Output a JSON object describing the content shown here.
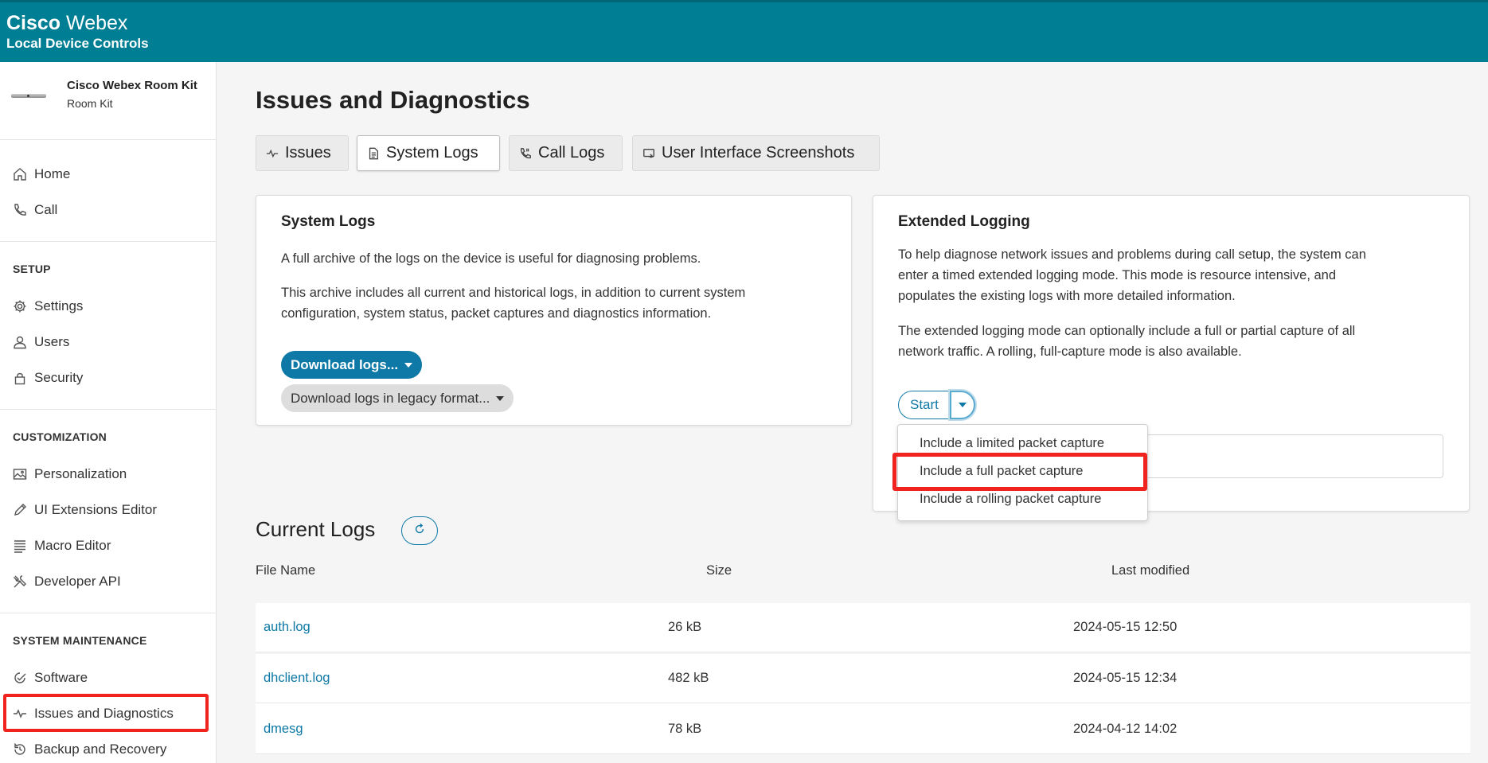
{
  "header": {
    "brand_bold": "Cisco",
    "brand_light": "Webex",
    "subtitle": "Local Device Controls"
  },
  "device": {
    "name": "Cisco Webex Room Kit",
    "model": "Room Kit"
  },
  "sidebar": {
    "items_top": [
      {
        "label": "Home",
        "icon": "home-icon"
      },
      {
        "label": "Call",
        "icon": "phone-icon"
      }
    ],
    "setup_title": "SETUP",
    "setup_items": [
      {
        "label": "Settings",
        "icon": "gear-icon"
      },
      {
        "label": "Users",
        "icon": "user-icon"
      },
      {
        "label": "Security",
        "icon": "lock-icon"
      }
    ],
    "customization_title": "CUSTOMIZATION",
    "customization_items": [
      {
        "label": "Personalization",
        "icon": "image-icon"
      },
      {
        "label": "UI Extensions Editor",
        "icon": "pencil-icon"
      },
      {
        "label": "Macro Editor",
        "icon": "lines-icon"
      },
      {
        "label": "Developer API",
        "icon": "tools-icon"
      }
    ],
    "maintenance_title": "SYSTEM MAINTENANCE",
    "maintenance_items": [
      {
        "label": "Software",
        "icon": "software-icon"
      },
      {
        "label": "Issues and Diagnostics",
        "icon": "pulse-icon"
      },
      {
        "label": "Backup and Recovery",
        "icon": "history-icon"
      }
    ]
  },
  "page": {
    "title": "Issues and Diagnostics",
    "tabs": [
      {
        "label": "Issues",
        "icon": "pulse-icon"
      },
      {
        "label": "System Logs",
        "icon": "document-icon"
      },
      {
        "label": "Call Logs",
        "icon": "call-log-icon"
      },
      {
        "label": "User Interface Screenshots",
        "icon": "screenshot-icon"
      }
    ]
  },
  "system_logs": {
    "title": "System Logs",
    "text1": "A full archive of the logs on the device is useful for diagnosing problems.",
    "text2_line1": "This archive includes all current and historical logs, in addition to current system",
    "text2_line2": "configuration, system status, packet captures and diagnostics information.",
    "download_label": "Download logs...",
    "legacy_label": "Download logs in legacy format..."
  },
  "extended_logging": {
    "title": "Extended Logging",
    "p1_line1": "To help diagnose network issues and problems during call setup, the system can",
    "p1_line2": "enter a timed extended logging mode. This mode is resource intensive, and",
    "p1_line3": "populates the existing logs with more detailed information.",
    "p2_line1": "The extended logging mode can optionally include a full or partial capture of all",
    "p2_line2": "network traffic. A rolling, full-capture mode is also available.",
    "start_label": "Start",
    "options": [
      "Include a limited packet capture",
      "Include a full packet capture",
      "Include a rolling packet capture"
    ]
  },
  "current_logs": {
    "title": "Current Logs",
    "columns": [
      "File Name",
      "Size",
      "Last modified"
    ],
    "rows": [
      {
        "name": "auth.log",
        "size": "26 kB",
        "modified": "2024-05-15 12:50"
      },
      {
        "name": "dhclient.log",
        "size": "482 kB",
        "modified": "2024-05-15 12:34"
      },
      {
        "name": "dmesg",
        "size": "78 kB",
        "modified": "2024-04-12 14:02"
      }
    ]
  },
  "colors": {
    "header_bg": "#007f94",
    "accent": "#0e79a6",
    "highlight": "#f0231e"
  }
}
